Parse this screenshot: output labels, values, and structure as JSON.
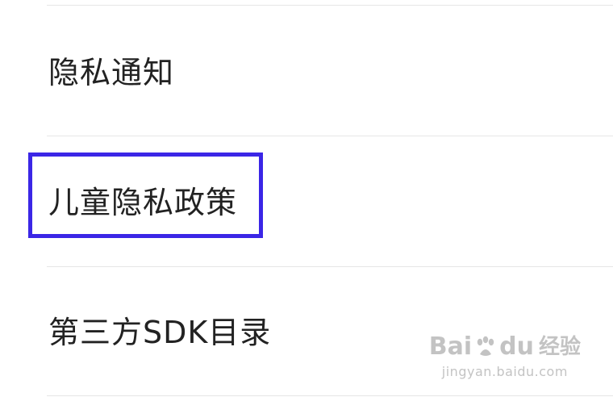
{
  "menu": {
    "items": [
      {
        "label": "隐私通知"
      },
      {
        "label": "儿童隐私政策"
      },
      {
        "label": "第三方SDK目录"
      }
    ]
  },
  "highlight": {
    "color": "#3b26e6"
  },
  "watermark": {
    "logo_left": "Bai",
    "logo_right": "du",
    "logo_cn": "经验",
    "site": "jingyan.baidu.com"
  }
}
